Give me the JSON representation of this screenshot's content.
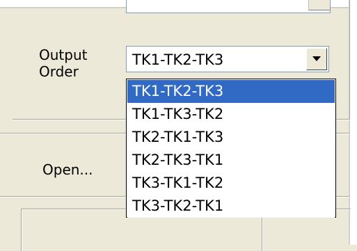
{
  "output_order": {
    "label_line1": "Output",
    "label_line2": "Order",
    "selected_value": "TK1-TK2-TK3",
    "options": [
      "TK1-TK2-TK3",
      "TK1-TK3-TK2",
      "TK2-TK1-TK3",
      "TK2-TK3-TK1",
      "TK3-TK1-TK2",
      "TK3-TK2-TK1"
    ],
    "highlighted_index": 0
  },
  "buttons": {
    "open_label": "Open..."
  },
  "icons": {
    "dropdown_arrow": "chevron-down-icon"
  },
  "colors": {
    "window_background": "#ece9d8",
    "selection_highlight": "#316ac5",
    "selection_text": "#ffffff",
    "field_border": "#7f9db9"
  }
}
